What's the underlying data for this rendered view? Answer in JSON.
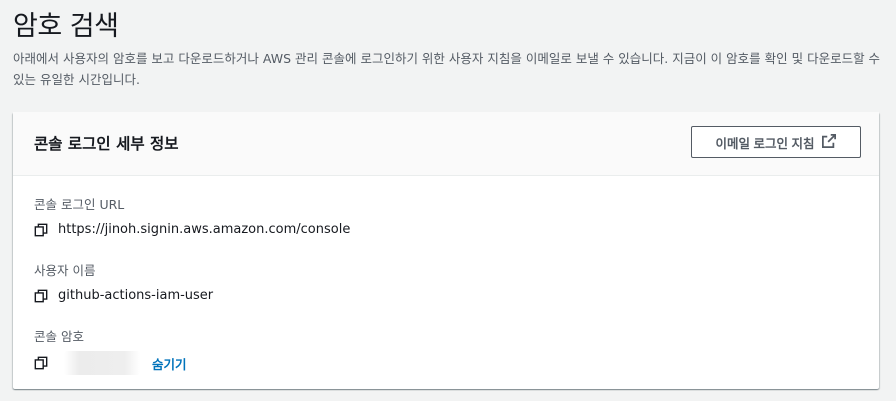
{
  "page": {
    "title": "암호 검색",
    "description": "아래에서 사용자의 암호를 보고 다운로드하거나 AWS 관리 콘솔에 로그인하기 위한 사용자 지침을 이메일로 보낼 수 있습니다. 지금이 이 암호를 확인 및 다운로드할 수 있는 유일한 시간입니다."
  },
  "card": {
    "title": "콘솔 로그인 세부 정보",
    "email_button_label": "이메일 로그인 지침",
    "email_button_icon": "external-link-icon",
    "fields": [
      {
        "label": "콘솔 로그인 URL",
        "value": "https://jinoh.signin.aws.amazon.com/console",
        "icon": "copy-icon"
      },
      {
        "label": "사용자 이름",
        "value": "github-actions-iam-user",
        "icon": "copy-icon"
      },
      {
        "label": "콘솔 암호",
        "value": "",
        "icon": "copy-icon",
        "toggle_label": "숨기기"
      }
    ]
  },
  "colors": {
    "background": "#f2f3f3",
    "link": "#0073bb",
    "secondary_text": "#545b64"
  }
}
